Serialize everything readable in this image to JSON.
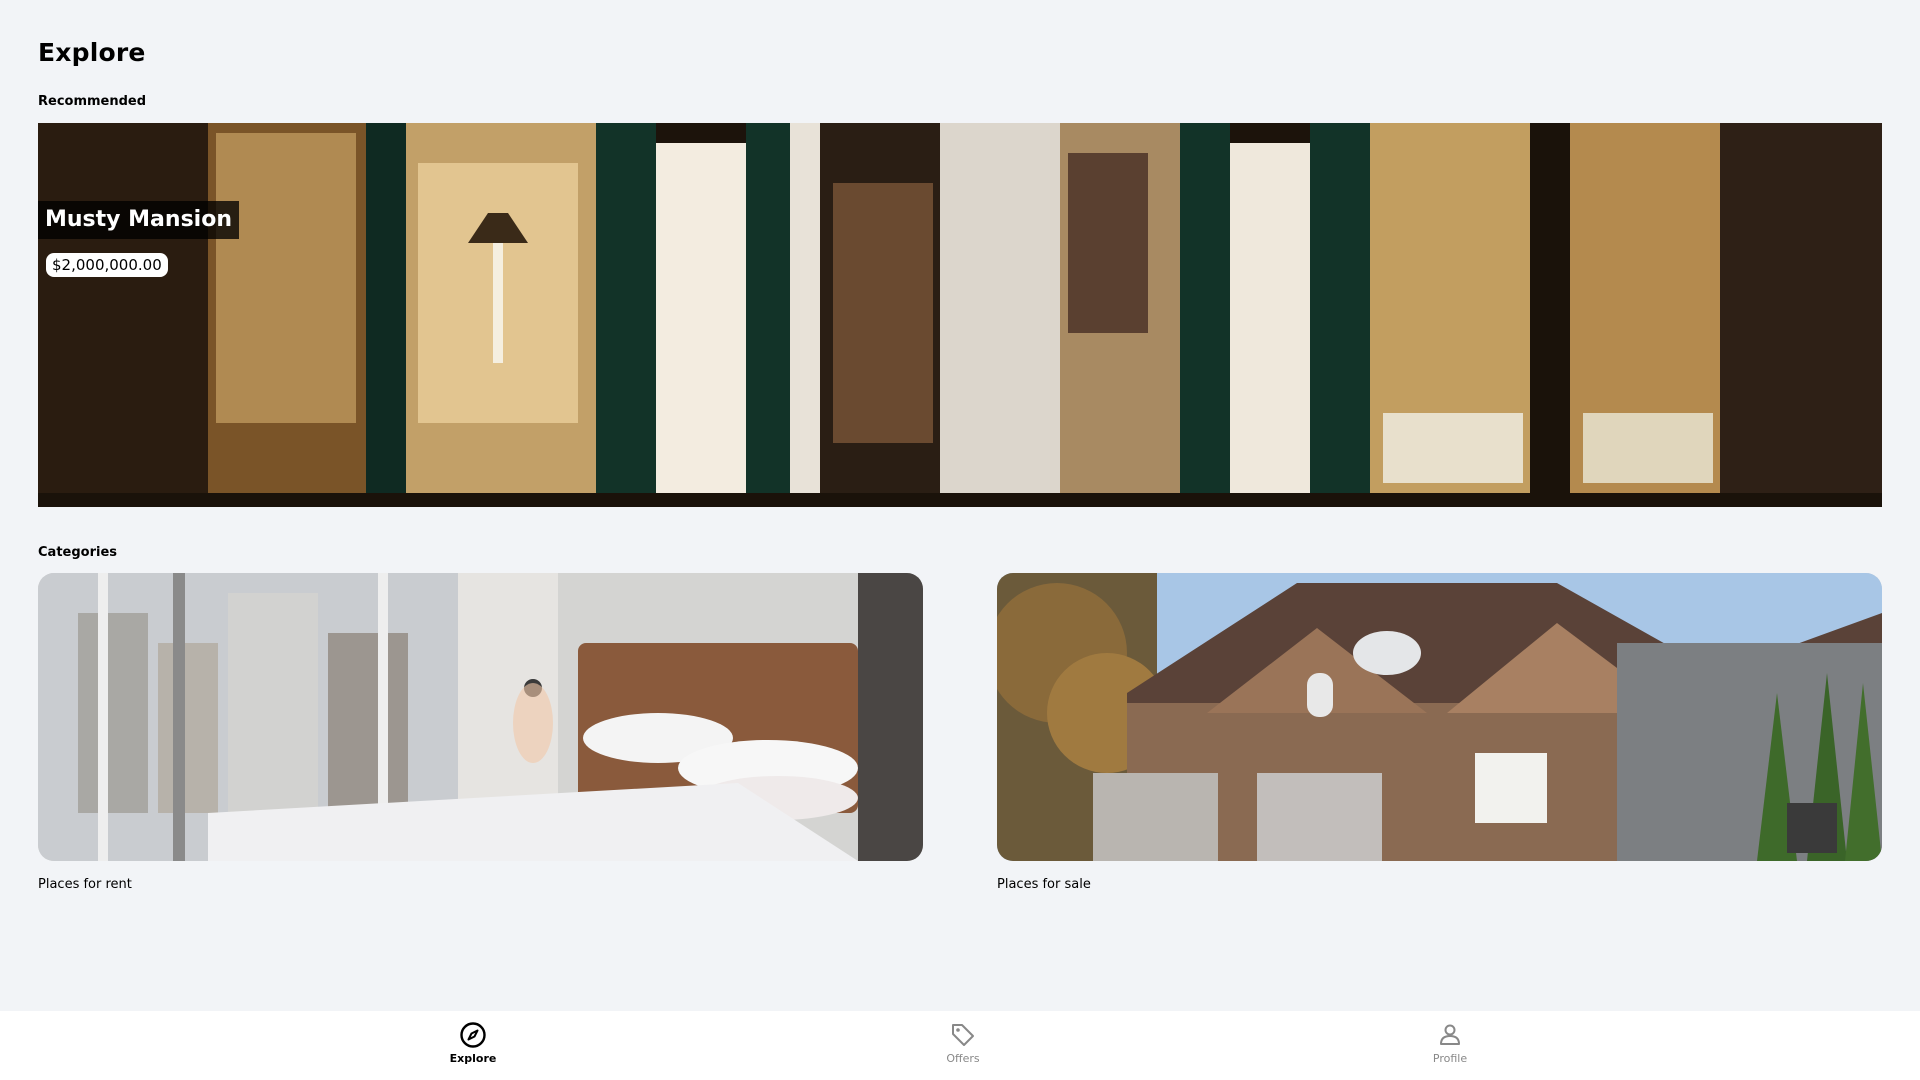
{
  "page": {
    "title": "Explore"
  },
  "recommended": {
    "section_label": "Recommended",
    "listing": {
      "name": "Musty Mansion",
      "price": "$2,000,000.00"
    }
  },
  "categories": {
    "section_label": "Categories",
    "items": [
      {
        "label": "Places for rent",
        "image": "bedroom-with-city-view"
      },
      {
        "label": "Places for sale",
        "image": "brick-house-exterior"
      }
    ]
  },
  "bottom_nav": {
    "items": [
      {
        "label": "Explore",
        "icon": "compass-icon",
        "active": true
      },
      {
        "label": "Offers",
        "icon": "tag-icon",
        "active": false
      },
      {
        "label": "Profile",
        "icon": "person-icon",
        "active": false
      }
    ]
  },
  "colors": {
    "background": "#f2f4f7",
    "nav_background": "#ffffff",
    "active": "#000000",
    "inactive": "#888888"
  }
}
